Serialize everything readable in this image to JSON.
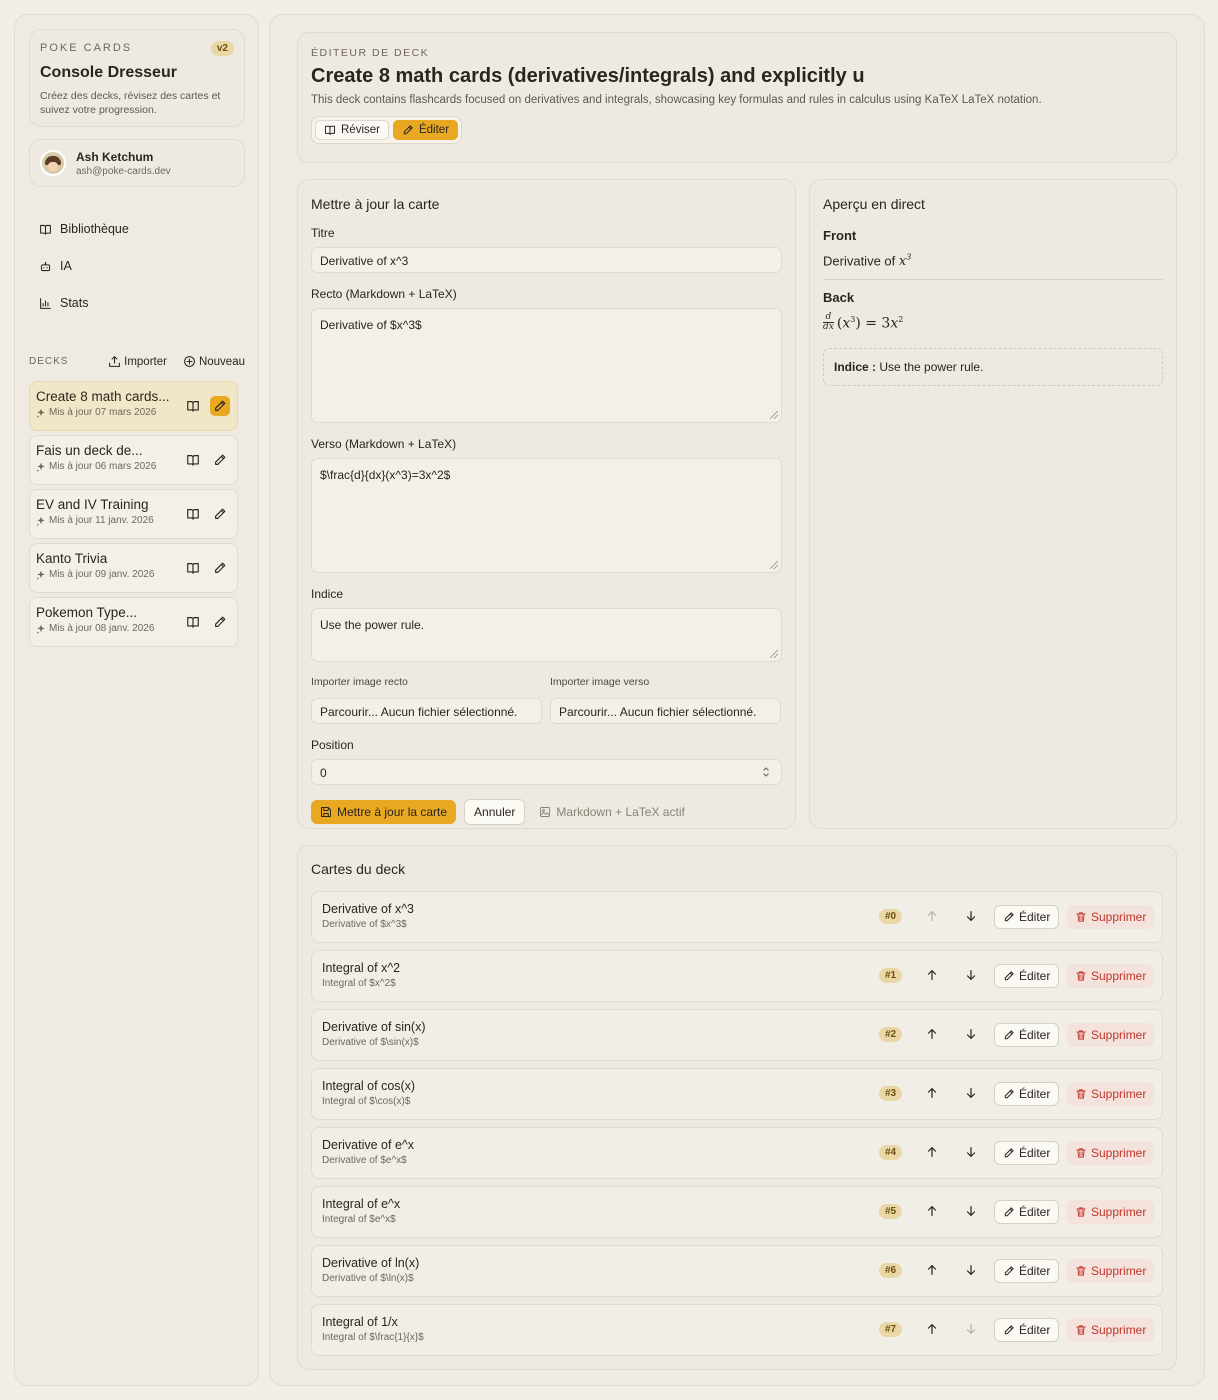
{
  "brand": {
    "kicker": "POKE CARDS",
    "version": "v2",
    "title": "Console Dresseur",
    "description": "Créez des decks, révisez des cartes et suivez votre progression."
  },
  "user": {
    "name": "Ash Ketchum",
    "email": "ash@poke-cards.dev"
  },
  "nav": [
    {
      "label": "Bibliothèque",
      "icon": "book-icon"
    },
    {
      "label": "IA",
      "icon": "bot-icon"
    },
    {
      "label": "Stats",
      "icon": "bar-chart-icon"
    }
  ],
  "decks_section": {
    "label": "DECKS",
    "import_label": "Importer",
    "new_label": "Nouveau"
  },
  "decks": [
    {
      "title": "Create 8 math cards...",
      "updated": "Mis à jour 07 mars 2026",
      "active": true
    },
    {
      "title": "Fais un deck de...",
      "updated": "Mis à jour 06 mars 2026",
      "active": false
    },
    {
      "title": "EV and IV Training",
      "updated": "Mis à jour 11 janv. 2026",
      "active": false
    },
    {
      "title": "Kanto Trivia",
      "updated": "Mis à jour 09 janv. 2026",
      "active": false
    },
    {
      "title": "Pokemon Type...",
      "updated": "Mis à jour 08 janv. 2026",
      "active": false
    }
  ],
  "header": {
    "kicker": "ÉDITEUR DE DECK",
    "title": "Create 8 math cards (derivatives/integrals) and explicitly u",
    "description": "This deck contains flashcards focused on derivatives and integrals, showcasing key formulas and rules in calculus using KaTeX LaTeX notation.",
    "review_label": "Réviser",
    "edit_label": "Éditer"
  },
  "form": {
    "section_title": "Mettre à jour la carte",
    "title_label": "Titre",
    "title_value": "Derivative of x^3",
    "front_label": "Recto (Markdown + LaTeX)",
    "front_value": "Derivative of $x^3$",
    "back_label": "Verso (Markdown + LaTeX)",
    "back_value": "$\\frac{d}{dx}(x^3)=3x^2$",
    "hint_label": "Indice",
    "hint_value": "Use the power rule.",
    "front_image_label": "Importer image recto",
    "back_image_label": "Importer image verso",
    "file_placeholder": "Parcourir... Aucun fichier sélectionné.",
    "position_label": "Position",
    "position_value": "0",
    "submit_label": "Mettre à jour la carte",
    "cancel_label": "Annuler",
    "mode_hint": "Markdown + LaTeX actif"
  },
  "preview": {
    "section_title": "Aperçu en direct",
    "front_label": "Front",
    "front_text": "Derivative of",
    "back_label": "Back",
    "hint_prefix": "Indice :",
    "hint_text": "Use the power rule."
  },
  "cards_section": {
    "title": "Cartes du deck",
    "edit_label": "Éditer",
    "delete_label": "Supprimer"
  },
  "cards": [
    {
      "title": "Derivative of x^3",
      "front": "Derivative of $x^3$",
      "position": "#0"
    },
    {
      "title": "Integral of x^2",
      "front": "Integral of $x^2$",
      "position": "#1"
    },
    {
      "title": "Derivative of sin(x)",
      "front": "Derivative of $\\sin(x)$",
      "position": "#2"
    },
    {
      "title": "Integral of cos(x)",
      "front": "Integral of $\\cos(x)$",
      "position": "#3"
    },
    {
      "title": "Derivative of e^x",
      "front": "Derivative of $e^x$",
      "position": "#4"
    },
    {
      "title": "Integral of e^x",
      "front": "Integral of $e^x$",
      "position": "#5"
    },
    {
      "title": "Derivative of ln(x)",
      "front": "Derivative of $\\ln(x)$",
      "position": "#6"
    },
    {
      "title": "Integral of 1/x",
      "front": "Integral of $\\frac{1}{x}$",
      "position": "#7"
    }
  ],
  "colors": {
    "accent": "#e8a821",
    "danger": "#c0362c",
    "background": "#f1eee6"
  }
}
